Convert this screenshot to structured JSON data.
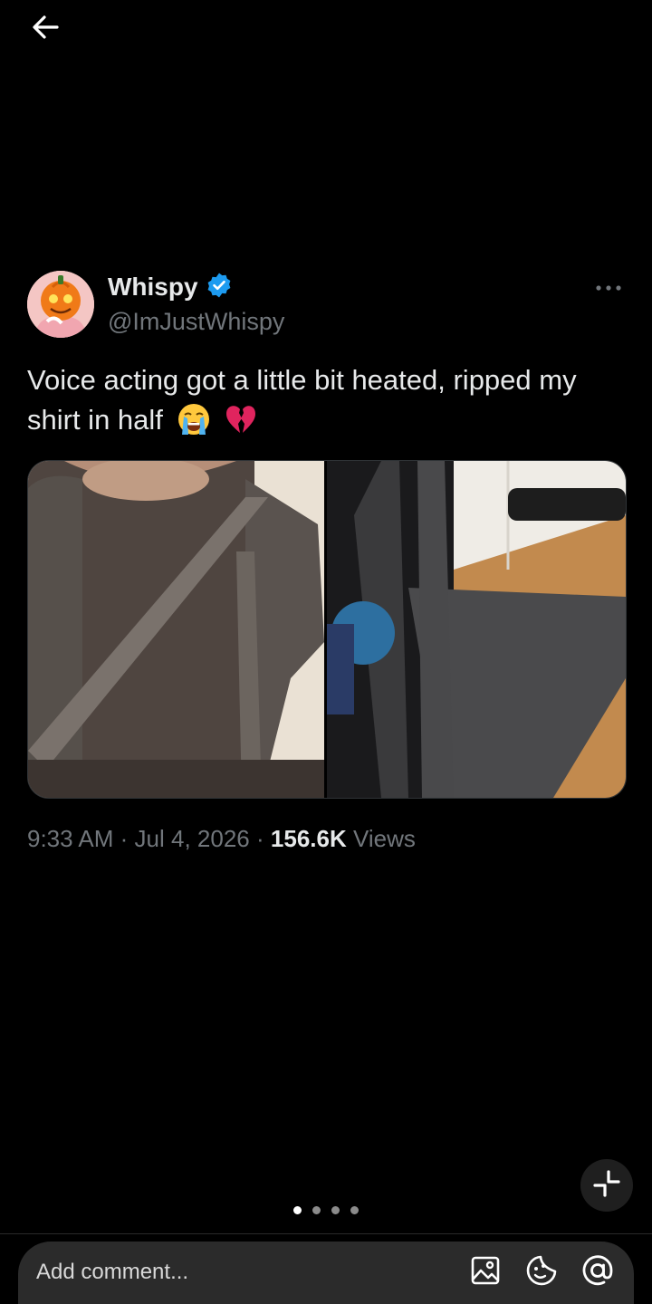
{
  "post": {
    "author_name": "Whispy",
    "author_handle": "@ImJustWhispy",
    "verified": true,
    "text": "Voice acting got a little bit heated, ripped my shirt in half",
    "emojis": [
      "loudly-crying-face",
      "broken-heart"
    ],
    "time": "9:33 AM",
    "date": "Jul 4, 2026",
    "separator": "·",
    "views_count": "156.6K",
    "views_label": "Views",
    "media": [
      {
        "description_icon": "photo-shirt-torn-worn"
      },
      {
        "description_icon": "photo-shirt-on-floor"
      }
    ]
  },
  "pager": {
    "count": 4,
    "active": 0
  },
  "comment": {
    "placeholder": "Add comment..."
  },
  "icons": {
    "back": "back-arrow-icon",
    "more": "more-dots-icon",
    "verified": "verified-badge-icon",
    "collapse": "collapse-icon",
    "image": "image-icon",
    "sticker": "sticker-icon",
    "mention": "at-mention-icon"
  },
  "colors": {
    "background": "#000000",
    "text_primary": "#e7e9ea",
    "text_secondary": "#71767b",
    "verified_blue": "#1d9bf0",
    "input_bg": "#2b2b2b"
  }
}
